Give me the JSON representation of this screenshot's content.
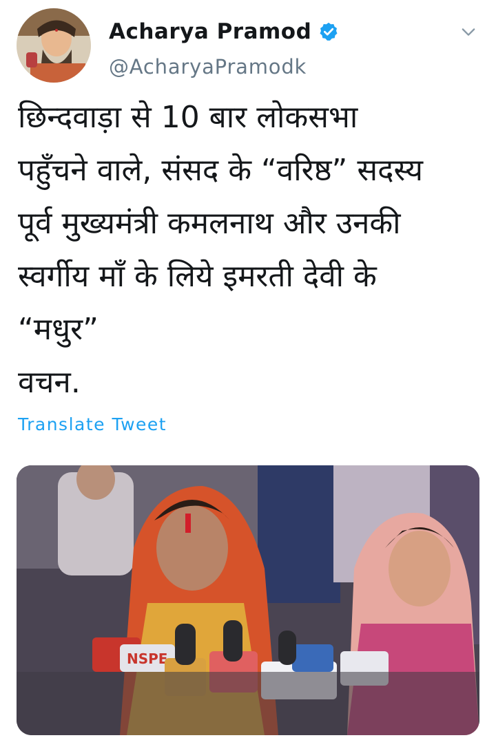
{
  "author": {
    "display_name": "Acharya Pramod",
    "handle": "@AcharyaPramodk",
    "verified": true,
    "avatar_icon": "profile-photo"
  },
  "tweet": {
    "text": "छिन्दवाड़ा से 10 बार लोकसभा\nपहुँचने वाले, संसद के “वरिष्ठ” सदस्य\nपूर्व मुख्यमंत्री कमलनाथ और उनकी\nस्वर्गीय माँ के लिये इमरती देवी के\n“मधुर”\nवचन.",
    "translate_label": "Translate Tweet"
  },
  "media": {
    "type": "image",
    "mic_labels": [
      "NSPE"
    ]
  },
  "colors": {
    "accent": "#1da1f2",
    "text": "#14171a",
    "muted": "#657786",
    "verified": "#1da1f2"
  }
}
